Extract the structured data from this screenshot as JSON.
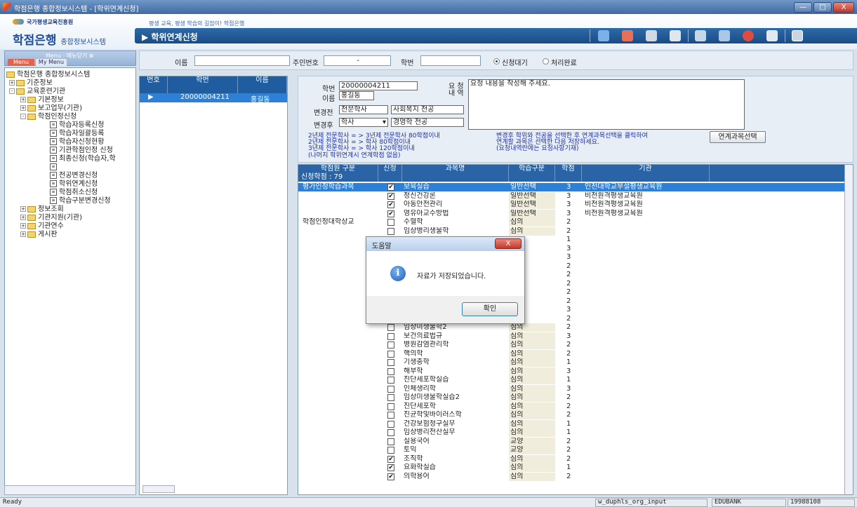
{
  "window": {
    "title": "학점은행 종합정보시스템 - [학위연계신청]",
    "buttons": [
      "—",
      "□",
      "X"
    ]
  },
  "header": {
    "org": "국가평생교육진흥원",
    "slogan": "평생 교육, 평생 학습의 길잡이! 학점은행",
    "brand": "학점은행",
    "brand_sub": "종합정보시스템",
    "page_title": "▶ 학위연계신청"
  },
  "menu": {
    "title": "Menu : 메뉴닫기 ⊗",
    "tabs": [
      "Menu",
      "My Menu"
    ],
    "tree": [
      "학점은행 종합정보시스템",
      "기준정보",
      "교육훈련기관",
      "기본정보",
      "보고업무(기관)",
      "학점인정신청",
      "학습자등록신청",
      "학습자일괄등록",
      "학습자신청현황",
      "기관학점인정 신청",
      "최종신청(학습자,학",
      "",
      "전공변경신청",
      "학위연계신청",
      "학점취소신청",
      "학습구분변경신청",
      "정보조회",
      "기관지원(기관)",
      "기관연수",
      "게시판"
    ]
  },
  "search": {
    "name_label": "이름",
    "name_value": "",
    "jumin_label": "주민번호",
    "jumin_value": "-",
    "hakbun_label": "학번",
    "hakbun_value": "",
    "radio1": "신청대기",
    "radio2": "처리완료"
  },
  "list": {
    "headers": [
      "번호",
      "학번",
      "이름"
    ],
    "rows": [
      {
        "no": "▶",
        "hakbun": "20000004211",
        "name": "홍길동"
      }
    ]
  },
  "detail": {
    "hakbun_label": "학번",
    "hakbun": "20000004211",
    "name_label": "이름",
    "name": "홍길동",
    "before_label": "변경전",
    "before_degree": "전문학사",
    "before_major": "사회복지 전공",
    "after_label": "변경후",
    "after_degree": "학사",
    "after_major": "경영학 전공",
    "request_label_1": "요 청",
    "request_label_2": "내 역",
    "request_text": "요청 내용을 작성해 주세요.",
    "notes": [
      "2년제 전문학사  = > 3년제 전문학사 80학점이내",
      "2년제 전문학사  = > 학사          80학점이내",
      "3년제 전문학사  = > 학사          120학점이내",
      "(나머지 학위연계시 연계학점 없음)"
    ],
    "notes_right": [
      "변경후 학위와 전공을 선택한 후 연계과목선택을 클릭하여",
      "연계할 과목은 선택한 다음 저장하세요.",
      "(요청내역란에는 요청사항기재)"
    ],
    "link_button": "연계과목선택"
  },
  "grid": {
    "headers": [
      "학점원 구분",
      "신청",
      "과목명",
      "학습구분",
      "학점",
      "기관"
    ],
    "subheader": "신청학점 : 79",
    "rows": [
      {
        "group": "평가인정학습과목",
        "checked": true,
        "name": "보육실습",
        "type": "일반선택",
        "credit": "3",
        "org": "인천대학교부설평생교육원",
        "sel": true
      },
      {
        "group": "",
        "checked": true,
        "name": "정신건강론",
        "type": "일반선택",
        "credit": "3",
        "org": "비전원격평생교육원"
      },
      {
        "group": "",
        "checked": true,
        "name": "아동안전관리",
        "type": "일반선택",
        "credit": "3",
        "org": "비전원격평생교육원"
      },
      {
        "group": "",
        "checked": true,
        "name": "영유아교수방법",
        "type": "일반선택",
        "credit": "3",
        "org": "비전원격평생교육원"
      },
      {
        "group": "학점인정대학상교",
        "checked": false,
        "name": "수혈학",
        "type": "심의",
        "credit": "2",
        "org": ""
      },
      {
        "group": "",
        "checked": false,
        "name": "임상병리생물학",
        "type": "심의",
        "credit": "2",
        "org": ""
      },
      {
        "group": "",
        "checked": false,
        "name": "",
        "type": "",
        "credit": "1",
        "org": ""
      },
      {
        "group": "",
        "checked": false,
        "name": "",
        "type": "",
        "credit": "3",
        "org": ""
      },
      {
        "group": "",
        "checked": false,
        "name": "",
        "type": "",
        "credit": "3",
        "org": ""
      },
      {
        "group": "",
        "checked": false,
        "name": "",
        "type": "",
        "credit": "2",
        "org": ""
      },
      {
        "group": "",
        "checked": false,
        "name": "",
        "type": "",
        "credit": "2",
        "org": ""
      },
      {
        "group": "",
        "checked": false,
        "name": "",
        "type": "",
        "credit": "2",
        "org": ""
      },
      {
        "group": "",
        "checked": false,
        "name": "",
        "type": "",
        "credit": "2",
        "org": ""
      },
      {
        "group": "",
        "checked": false,
        "name": "",
        "type": "",
        "credit": "2",
        "org": ""
      },
      {
        "group": "",
        "checked": false,
        "name": "",
        "type": "",
        "credit": "3",
        "org": ""
      },
      {
        "group": "",
        "checked": false,
        "name": "",
        "type": "",
        "credit": "2",
        "org": ""
      },
      {
        "group": "",
        "checked": false,
        "name": "임상미생물학2",
        "type": "심의",
        "credit": "2",
        "org": ""
      },
      {
        "group": "",
        "checked": false,
        "name": "보건의료법규",
        "type": "심의",
        "credit": "3",
        "org": ""
      },
      {
        "group": "",
        "checked": false,
        "name": "병원감염관리학",
        "type": "심의",
        "credit": "2",
        "org": ""
      },
      {
        "group": "",
        "checked": false,
        "name": "핵의학",
        "type": "심의",
        "credit": "2",
        "org": ""
      },
      {
        "group": "",
        "checked": false,
        "name": "기생충학",
        "type": "심의",
        "credit": "1",
        "org": ""
      },
      {
        "group": "",
        "checked": false,
        "name": "해부학",
        "type": "심의",
        "credit": "3",
        "org": ""
      },
      {
        "group": "",
        "checked": false,
        "name": "진단세포학실습",
        "type": "심의",
        "credit": "1",
        "org": ""
      },
      {
        "group": "",
        "checked": false,
        "name": "인체생리학",
        "type": "심의",
        "credit": "3",
        "org": ""
      },
      {
        "group": "",
        "checked": false,
        "name": "임상미생물학실습2",
        "type": "심의",
        "credit": "2",
        "org": ""
      },
      {
        "group": "",
        "checked": false,
        "name": "진단세포학",
        "type": "심의",
        "credit": "2",
        "org": ""
      },
      {
        "group": "",
        "checked": false,
        "name": "진균학및바이러스학",
        "type": "심의",
        "credit": "2",
        "org": ""
      },
      {
        "group": "",
        "checked": false,
        "name": "건강보험청구실무",
        "type": "심의",
        "credit": "1",
        "org": ""
      },
      {
        "group": "",
        "checked": false,
        "name": "임상병리전산실무",
        "type": "심의",
        "credit": "1",
        "org": ""
      },
      {
        "group": "",
        "checked": false,
        "name": "실용국어",
        "type": "교양",
        "credit": "2",
        "org": ""
      },
      {
        "group": "",
        "checked": false,
        "name": "토익",
        "type": "교양",
        "credit": "2",
        "org": ""
      },
      {
        "group": "",
        "checked": true,
        "name": "조직학",
        "type": "심의",
        "credit": "2",
        "org": ""
      },
      {
        "group": "",
        "checked": true,
        "name": "요화학실습",
        "type": "심의",
        "credit": "1",
        "org": ""
      },
      {
        "group": "",
        "checked": true,
        "name": "의학용어",
        "type": "심의",
        "credit": "2",
        "org": ""
      }
    ]
  },
  "dialog": {
    "title": "도움말",
    "close": "X",
    "message": "자료가 저장되었습니다.",
    "ok": "확인"
  },
  "status": {
    "left": "Ready",
    "pane1": "w_duphls_org_input",
    "pane2": "EDUBANK",
    "pane3": "19988108"
  },
  "icons": [
    "back-icon",
    "forward-icon",
    "home-icon",
    "save-icon",
    "print-icon",
    "monitor-icon",
    "help-icon",
    "exit-icon",
    "close-window-icon"
  ],
  "colors": {
    "accent": "#1f5da0",
    "selected_row": "#2e7fd6",
    "header_bar": "#1a4c85"
  }
}
